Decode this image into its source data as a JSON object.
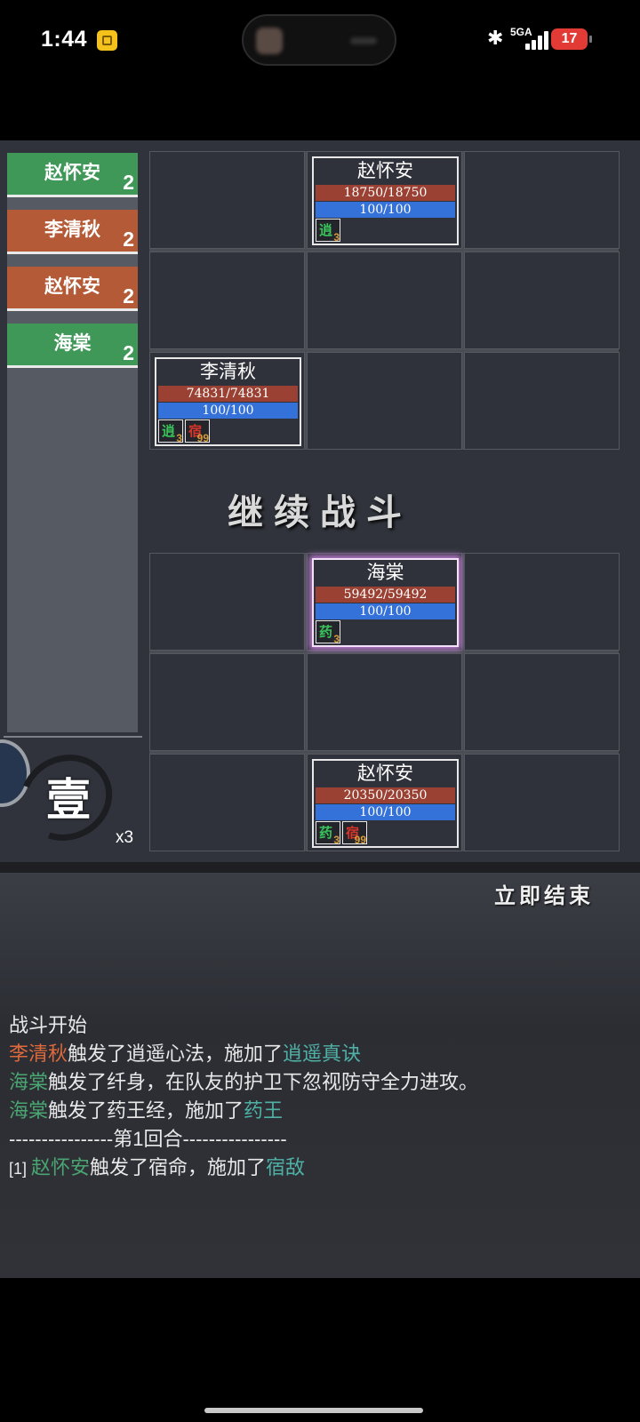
{
  "status_bar": {
    "time": "1:44",
    "network": "5GA",
    "battery": "17",
    "bluetooth_icon": "bluetooth-icon",
    "signal_icon": "signal-bars-icon"
  },
  "turn_order": [
    {
      "name": "赵怀安",
      "count": "2",
      "color": "green"
    },
    {
      "name": "李清秋",
      "count": "2",
      "color": "rust"
    },
    {
      "name": "赵怀安",
      "count": "2",
      "color": "rust"
    },
    {
      "name": "海棠",
      "count": "2",
      "color": "green"
    }
  ],
  "round": {
    "label": "壹",
    "speed": "x3"
  },
  "enemy_units": {
    "zhao": {
      "name": "赵怀安",
      "hp": "18750/18750",
      "mp": "100/100",
      "buffs": [
        {
          "glyph": "逍",
          "count": "3",
          "color": "#39c35a"
        }
      ]
    },
    "li": {
      "name": "李清秋",
      "hp": "74831/74831",
      "mp": "100/100",
      "buffs": [
        {
          "glyph": "逍",
          "count": "3",
          "color": "#39c35a"
        },
        {
          "glyph": "宿",
          "count": "99",
          "color": "#d8352a"
        }
      ]
    }
  },
  "ally_units": {
    "haitang": {
      "name": "海棠",
      "hp": "59492/59492",
      "mp": "100/100",
      "buffs": [
        {
          "glyph": "药",
          "count": "3",
          "color": "#39c35a"
        }
      ]
    },
    "zhao": {
      "name": "赵怀安",
      "hp": "20350/20350",
      "mp": "100/100",
      "buffs": [
        {
          "glyph": "药",
          "count": "3",
          "color": "#39c35a"
        },
        {
          "glyph": "宿",
          "count": "99",
          "color": "#d8352a"
        }
      ]
    }
  },
  "continue_label": "继续战斗",
  "end_button": "立即结束",
  "log": {
    "l1": "战斗开始",
    "l2_name": "李清秋",
    "l2_text": "触发了逍遥心法，施加了",
    "l2_effect": "逍遥真诀",
    "l3_name": "海棠",
    "l3_text": "触发了纤身，在队友的护卫下忽视防守全力进攻。",
    "l4_name": "海棠",
    "l4_text": "触发了药王经，施加了",
    "l4_effect": "药王",
    "l5": "----------------第1回合----------------",
    "l6_prefix": "[1] ",
    "l6_name": "赵怀安",
    "l6_text": "触发了宿命，施加了",
    "l6_effect": "宿敌"
  },
  "colors": {
    "turn_green": "#3f9858",
    "turn_rust": "#b45a37",
    "hp_bar": "#9a4133",
    "mp_bar": "#3471d8",
    "log_orange": "#de6a3c",
    "log_green": "#4aa572",
    "log_teal": "#4fb1a6"
  }
}
